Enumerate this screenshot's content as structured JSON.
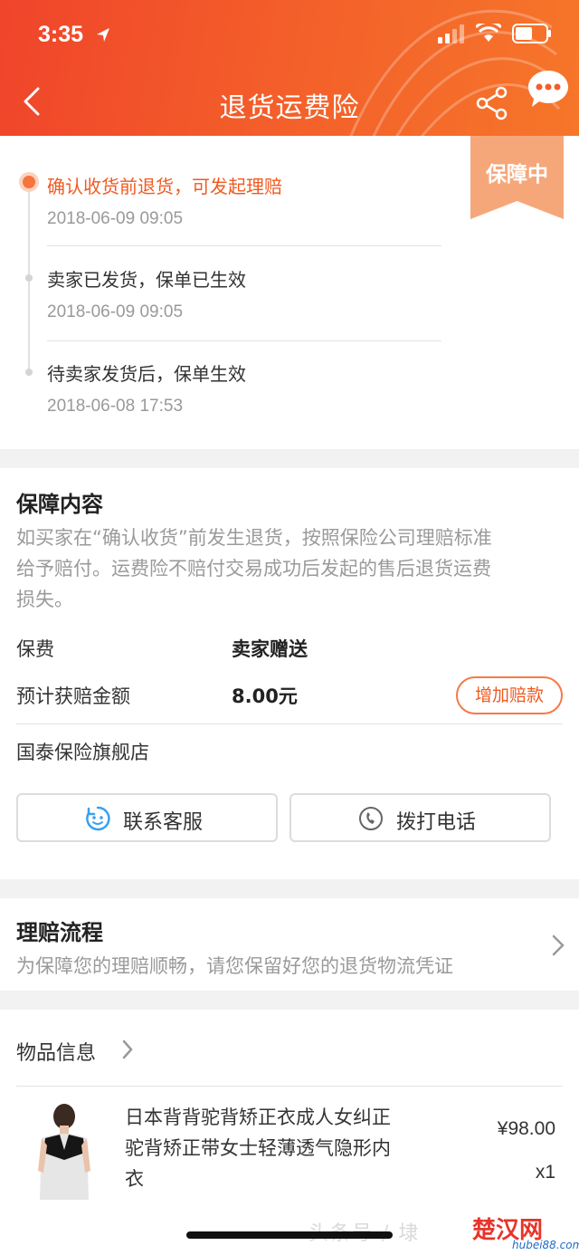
{
  "status_bar": {
    "time": "3:35"
  },
  "nav": {
    "title": "退货运费险"
  },
  "badge": {
    "text": "保障中"
  },
  "timeline": [
    {
      "title": "确认收货前退货，可发起理赔",
      "time": "2018-06-09 09:05"
    },
    {
      "title": "卖家已发货，保单已生效",
      "time": "2018-06-09 09:05"
    },
    {
      "title": "待卖家发货后，保单生效",
      "time": "2018-06-08 17:53"
    }
  ],
  "coverage": {
    "title": "保障内容",
    "description_lines": [
      "如买家在“确认收货”前发生退货，按照保险公司理赔标准",
      "给予赔付。运费险不赔付交易成功后发起的售后退货运费",
      "损失。"
    ],
    "premium_label": "保费",
    "premium_value": "卖家赠送",
    "payout_label": "预计获赔金额",
    "payout_value": "8.00元",
    "add_button": "增加赔款",
    "insurer": "国泰保险旗舰店",
    "contact_button": "联系客服",
    "call_button": "拨打电话"
  },
  "claim_process": {
    "title": "理赔流程",
    "subtitle": "为保障您的理赔顺畅，请您保留好您的退货物流凭证"
  },
  "goods": {
    "header": "物品信息",
    "title_lines": [
      "日本背背驼背矫正衣成人女纠正",
      "驼背矫正带女士轻薄透气隐形内",
      "衣"
    ],
    "price": "¥98.00",
    "quantity": "x1"
  },
  "watermark": {
    "text": "头条号 / 埭",
    "logo": "楚汉网",
    "url": "hubei88.com"
  },
  "colors": {
    "accent": "#f05a22",
    "header_start": "#f0442b",
    "header_end": "#f6762a"
  }
}
